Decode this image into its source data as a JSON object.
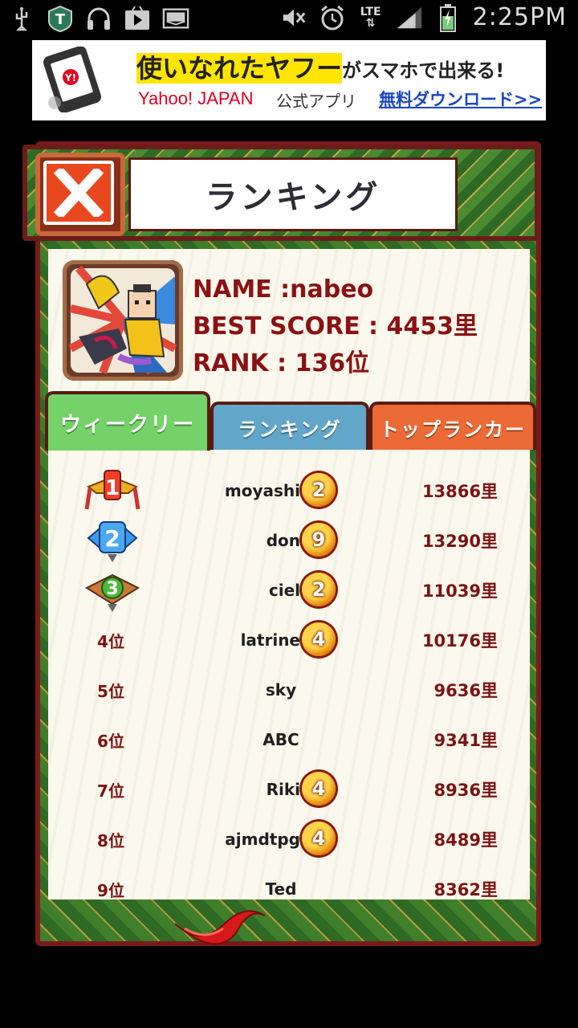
{
  "status_bar": {
    "time": "2:25PM",
    "network": "LTE",
    "left_icons": [
      "usb-icon",
      "app-t-icon",
      "headphones-icon",
      "play-store-icon",
      "mail-icon"
    ],
    "right_icons": [
      "mute-icon",
      "alarm-icon",
      "lte-icon",
      "signal-icon",
      "battery-icon"
    ]
  },
  "ad": {
    "headline_hl": "使いなれたヤフー",
    "headline_rest": "がスマホで出来る!",
    "brand": "Yahoo! JAPAN",
    "official": "公式アプリ",
    "cta": "無料ダウンロード>>"
  },
  "header": {
    "title": "ランキング",
    "close_icon": "close-icon"
  },
  "profile": {
    "name_line": "NAME :nabeo",
    "best_score_line": "BEST SCORE : 4453里",
    "rank_line": "RANK : 136位"
  },
  "tabs": [
    {
      "label": "ウィークリー",
      "color": "#74d269",
      "active": true
    },
    {
      "label": "ランキング",
      "color": "#62a7c9",
      "active": false
    },
    {
      "label": "トップランカー",
      "color": "#ec6a35",
      "active": false
    }
  ],
  "rankings": [
    {
      "rank": "1",
      "name": "moyashi",
      "badge": "2",
      "score": "13866里"
    },
    {
      "rank": "2",
      "name": "don",
      "badge": "9",
      "score": "13290里"
    },
    {
      "rank": "3",
      "name": "ciel",
      "badge": "2",
      "score": "11039里"
    },
    {
      "rank": "4位",
      "name": "latrine",
      "badge": "4",
      "score": "10176里"
    },
    {
      "rank": "5位",
      "name": "sky",
      "badge": "",
      "score": "9636里"
    },
    {
      "rank": "6位",
      "name": "ABC",
      "badge": "",
      "score": "9341里"
    },
    {
      "rank": "7位",
      "name": "Riki",
      "badge": "4",
      "score": "8936里"
    },
    {
      "rank": "8位",
      "name": "ajmdtpg",
      "badge": "4",
      "score": "8489里"
    },
    {
      "rank": "9位",
      "name": "Ted",
      "badge": "",
      "score": "8362里"
    }
  ],
  "colors": {
    "frame": "#7a1a1a",
    "accent_text": "#8a1212",
    "panel_bg": "#fbf8ee"
  }
}
